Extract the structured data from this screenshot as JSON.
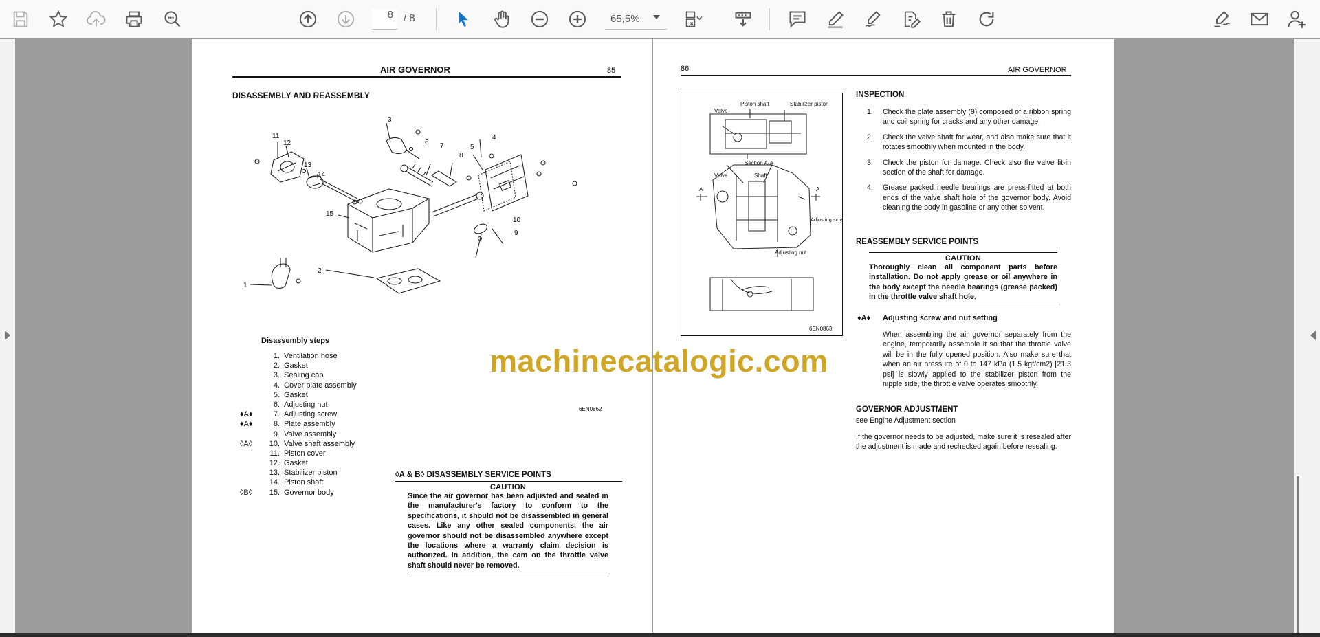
{
  "toolbar": {
    "current_page": "8",
    "page_total": "/ 8",
    "zoom_level": "65,5%",
    "icons": [
      "save-icon",
      "bookmark-star-icon",
      "upload-icon",
      "print-icon",
      "zoom-search-icon",
      "previous-page-icon",
      "next-page-icon",
      "select-arrow-icon",
      "hand-tool-icon",
      "zoom-out-icon",
      "zoom-in-icon",
      "page-display-icon",
      "scroll-mode-icon",
      "comment-icon",
      "highlight-pen-icon",
      "draw-icon",
      "stamp-edit-icon",
      "delete-icon",
      "rotate-icon",
      "fill-sign-icon",
      "email-icon",
      "add-user-icon"
    ]
  },
  "page85": {
    "header_title": "AIR GOVERNOR",
    "page_number": "85",
    "section_title": "DISASSEMBLY AND REASSEMBLY",
    "figure_code": "6EN0862",
    "callouts": [
      "1",
      "2",
      "3",
      "4",
      "5",
      "6",
      "7",
      "8",
      "9",
      "10",
      "11",
      "12",
      "13",
      "14",
      "15"
    ],
    "steps_title": "Disassembly steps",
    "steps": [
      {
        "mark": "",
        "num": "1.",
        "label": "Ventilation hose"
      },
      {
        "mark": "",
        "num": "2.",
        "label": "Gasket"
      },
      {
        "mark": "",
        "num": "3.",
        "label": "Sealing cap"
      },
      {
        "mark": "",
        "num": "4.",
        "label": "Cover plate assembly"
      },
      {
        "mark": "",
        "num": "5.",
        "label": "Gasket"
      },
      {
        "mark": "",
        "num": "6.",
        "label": "Adjusting nut"
      },
      {
        "mark": "♦A♦",
        "num": "7.",
        "label": "Adjusting screw"
      },
      {
        "mark": "♦A♦",
        "num": "8.",
        "label": "Plate assembly"
      },
      {
        "mark": "",
        "num": "9.",
        "label": "Valve assembly"
      },
      {
        "mark": "◊A◊",
        "num": "10.",
        "label": "Valve shaft assembly"
      },
      {
        "mark": "",
        "num": "11.",
        "label": "Piston cover"
      },
      {
        "mark": "",
        "num": "12.",
        "label": "Gasket"
      },
      {
        "mark": "",
        "num": "13.",
        "label": "Stabilizer piston"
      },
      {
        "mark": "",
        "num": "14.",
        "label": "Piston shaft"
      },
      {
        "mark": "◊B◊",
        "num": "15.",
        "label": "Governor body"
      }
    ],
    "service_title": "◊A & B◊ DISASSEMBLY SERVICE POINTS",
    "caution_title": "CAUTION",
    "caution_text": "Since the air governor has been adjusted and sealed in the manufacturer's factory to conform to the specifications, it should not be disassembled in general cases. Like any other sealed components, the air governor should not be disassembled anywhere except the locations where a warranty claim decision is authorized. In addition, the cam on the throttle valve shaft should never be removed."
  },
  "page86": {
    "page_number": "86",
    "header_title": "AIR GOVERNOR",
    "figure_labels": {
      "piston_shaft": "Piston shaft",
      "stabilizer_piston": "Stabilizer piston",
      "valve_top": "Valve",
      "section": "Section A-A",
      "valve_mid": "Valve",
      "shaft": "Shaft",
      "a_left": "A",
      "a_right": "A",
      "adjusting_screw": "Adjusting screw",
      "adjusting_nut": "Adjusting nut",
      "figure_code": "6EN0863"
    },
    "inspection_title": "INSPECTION",
    "inspection_items": [
      {
        "num": "1.",
        "text": "Check the plate assembly (9) composed of a ribbon spring and coil spring for cracks and any other damage."
      },
      {
        "num": "2.",
        "text": "Check the valve shaft for wear, and also make sure that it rotates smoothly when mounted in the body."
      },
      {
        "num": "3.",
        "text": "Check the piston for damage. Check also the valve fit-in section of the shaft for damage."
      },
      {
        "num": "4.",
        "text": "Grease packed needle bearings are press-fitted at both ends of the valve shaft hole of the governor body. Avoid cleaning the body in gasoline or any other solvent."
      }
    ],
    "reassembly_title": "REASSEMBLY SERVICE POINTS",
    "caution_title": "CAUTION",
    "caution_text": "Thoroughly clean all component parts before installation. Do not apply grease or oil anywhere in the body except the needle bearings (grease packed) in the throttle valve shaft hole.",
    "adjusting_mark": "♦A♦",
    "adjusting_title": "Adjusting screw and nut setting",
    "adjusting_text": "When assembling the air governor separately from the engine, temporarily assemble it so that the throttle valve will be in the fully opened position. Also make sure that when an air pressure of 0 to 147 kPa (1.5 kgf/cm2) [21.3 psi] is slowly applied to the stabilizer piston from the nipple side, the throttle valve operates smoothly.",
    "gov_adj_title": "GOVERNOR ADJUSTMENT",
    "gov_adj_sub": "see Engine Adjustment section",
    "gov_adj_text": "If the governor needs to be adjusted, make sure it is resealed after the adjustment is made and rechecked again before resealing."
  },
  "watermark": "machinecatalogic.com",
  "colors": {
    "watermark": "#cda21a",
    "select_arrow": "#1a73c9",
    "toolbar_icon": "#5a5a5a"
  }
}
